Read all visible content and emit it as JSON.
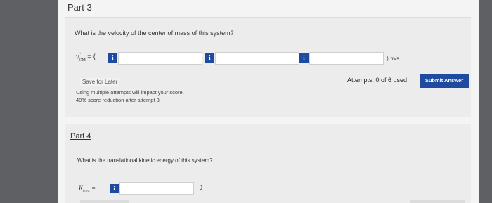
{
  "part3": {
    "title": "Part 3",
    "question": "What is the velocity of the center of mass of this system?",
    "vector_symbol": "v",
    "vector_arrow": "→",
    "vector_subscript": "CM",
    "vector_equals": "= ⟨",
    "components": [
      {
        "info_label": "i",
        "value": ""
      },
      {
        "info_label": "i",
        "value": ""
      },
      {
        "info_label": "i",
        "value": ""
      }
    ],
    "separator": ",",
    "unit": "⟩ m/s",
    "save_label": "Save for Later",
    "attempts_note_line1": "Using multiple attempts will impact your score.",
    "attempts_note_line2": "40% score reduction after attempt 3",
    "attempts_used": "Attempts: 0 of 6 used",
    "submit_label": "Submit Answer"
  },
  "part4": {
    "title": "Part 4",
    "question": "What is the translational kinetic energy of this system?",
    "symbol": "K",
    "subscript": "trans",
    "equals": "=",
    "info_label": "i",
    "value": "",
    "unit": "J"
  },
  "colors": {
    "accent": "#1e4ba0",
    "background": "#5e6064",
    "panel": "#ececec"
  }
}
